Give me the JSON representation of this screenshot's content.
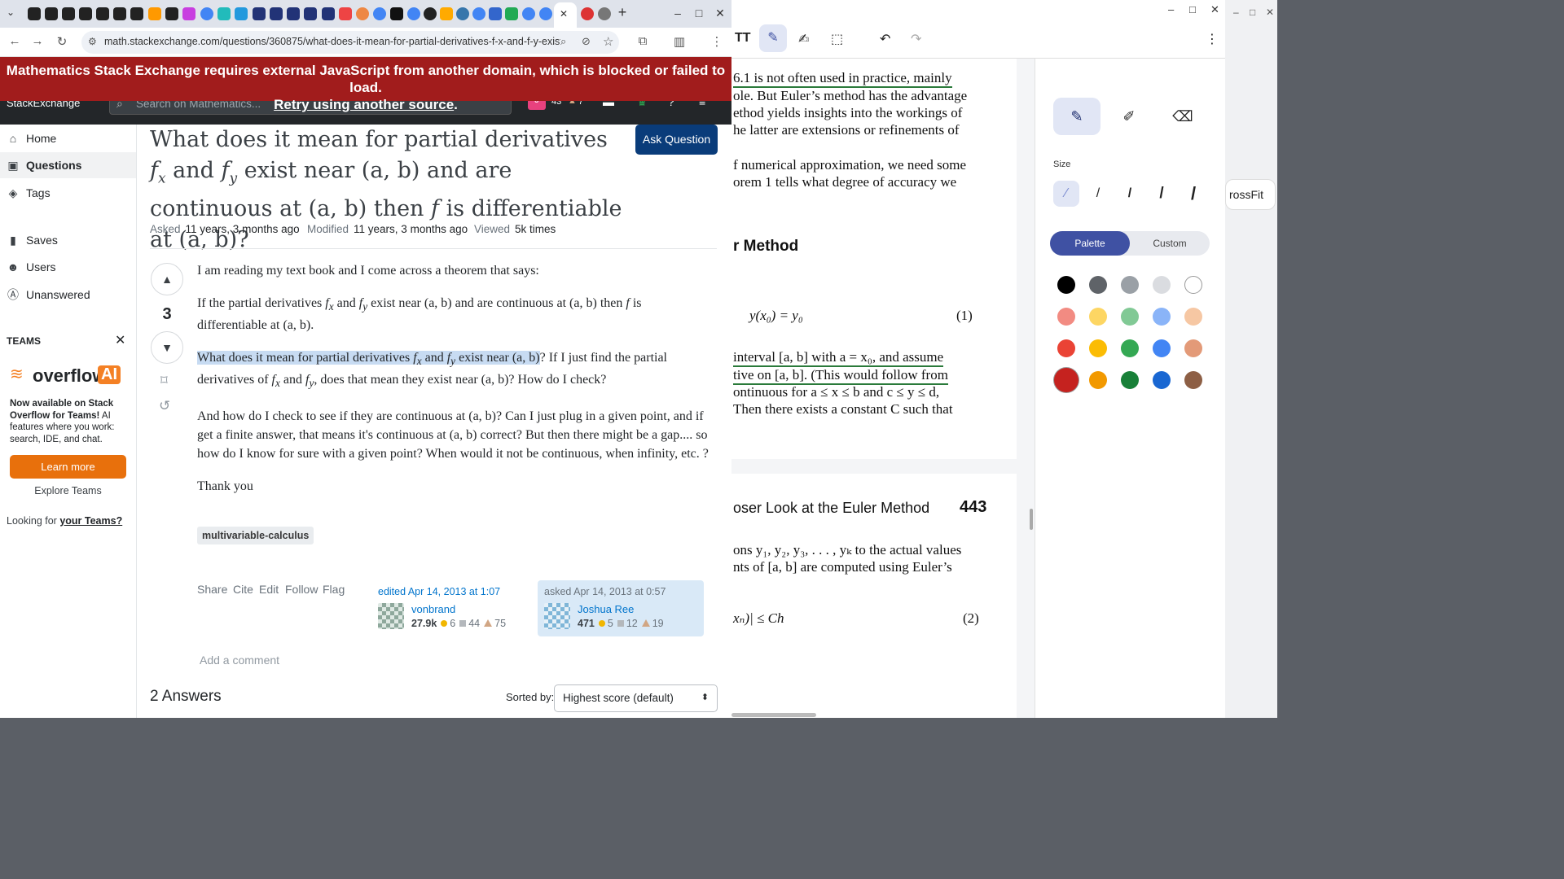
{
  "browser": {
    "url": "math.stackexchange.com/questions/360875/what-does-it-mean-for-partial-derivatives-f-x-and-f-y-exist-nea...",
    "new_tab": "+",
    "minimize": "–",
    "maximize": "□",
    "close": "✕",
    "tab_close": "✕"
  },
  "banner": {
    "line1": "Mathematics Stack Exchange requires external JavaScript from another domain, which is blocked or failed to load.",
    "retry_link": "Retry using another source",
    "period": "."
  },
  "sitebar": {
    "logo": "StackExchange",
    "search_placeholder": "Search on Mathematics...",
    "rep": "43",
    "badge_count": "7",
    "avatar_letter": "J"
  },
  "nav": {
    "home": "Home",
    "questions": "Questions",
    "tags": "Tags",
    "saves": "Saves",
    "users": "Users",
    "unanswered": "Unanswered",
    "teams_heading": "TEAMS",
    "teams_logo_a": "overflow",
    "teams_logo_b": "AI",
    "teams_text_bold": "Now available on Stack Overflow for Teams!",
    "teams_text": " AI features where you work: search, IDE, and chat.",
    "learn_more": "Learn more",
    "explore": "Explore Teams",
    "looking": "Looking for ",
    "your_teams": "your Teams?"
  },
  "question": {
    "title_a": "What does it mean for partial derivatives ",
    "title_b": " and ",
    "title_c": " exist near (a, b) and are continuous at (a, b) then ",
    "title_d": " is differentiable at (a, b)?",
    "ask_button": "Ask Question",
    "asked_label": "Asked",
    "asked_value": "11 years, 3 months ago",
    "modified_label": "Modified",
    "modified_value": "11 years, 3 months ago",
    "viewed_label": "Viewed",
    "viewed_value": "5k times",
    "score": "3",
    "p1": "I am reading my text book and I come across a theorem that says:",
    "p2a": "If the partial derivatives ",
    "p2b": " and ",
    "p2c": " exist near ",
    "p2d": " and are continuous at ",
    "p2e": " then ",
    "p2f": " is differentiable at ",
    "p2g": ".",
    "p3_highlight_a": "What does it mean for partial derivatives ",
    "p3_highlight_b": " and ",
    "p3_highlight_c": " exist near ",
    "p3_rest_a": "? If I just find the partial derivatives of ",
    "p3_rest_b": " and ",
    "p3_rest_c": ", does that mean they exist near ",
    "p3_rest_d": "? How do I check?",
    "p4a": "And how do I check to see if they are continuous at ",
    "p4b": "? Can I just plug in a given point, and if get a finite answer, that means it's continuous at ",
    "p4c": " correct? But then there might be a gap.... so how do I know for sure with a given point? When would it not be continuous, when infinity, etc. ?",
    "p5": "Thank you",
    "m_fx": "fx",
    "m_fy": "fy",
    "m_f": "f",
    "m_ab": "(a, b)",
    "tag": "multivariable-calculus",
    "actions": {
      "share": "Share",
      "cite": "Cite",
      "edit": "Edit",
      "follow": "Follow",
      "flag": "Flag"
    },
    "edited": {
      "label": "edited Apr 14, 2013 at 1:07",
      "user": "vonbrand",
      "rep": "27.9k",
      "gold": "6",
      "silver": "44",
      "bronze": "75"
    },
    "asked": {
      "label": "asked Apr 14, 2013 at 0:57",
      "user": "Joshua Ree",
      "rep": "471",
      "gold": "5",
      "silver": "12",
      "bronze": "19"
    },
    "add_comment": "Add a comment",
    "answers_heading": "2 Answers",
    "sorted_by": "Sorted by:",
    "sort_value": "Highest score (default)"
  },
  "pdf": {
    "l1": "6.1 is not often used in practice, mainly",
    "l2": "ole. But Euler’s method has the advantage",
    "l3": "ethod yields insights into the workings of",
    "l4": "he latter are extensions or refinements of",
    "l5": "f numerical approximation, we need some",
    "l6": "orem 1 tells what degree of accuracy we",
    "heading": "r Method",
    "eq1": "y(x₀) = y₀",
    "eq1_num": "(1)",
    "l7": "interval [a, b] with a = x₀, and assume",
    "l8": "tive on [a, b]. (This would follow from",
    "l9": "ontinuous for a ≤ x ≤ b and c ≤ y ≤ d,",
    "l10": "Then there exists a constant C such that",
    "page2_head": "oser Look at the Euler Method",
    "page2_num": "443",
    "l11": "ons y₁, y₂, y₃, . . . , yₖ to the actual values",
    "l12": "nts of [a, b] are computed using Euler’s",
    "eq2": "xₙ)| ≤ Ch",
    "eq2_num": "(2)"
  },
  "annot": {
    "size_label": "Size",
    "palette": "Palette",
    "custom": "Custom",
    "side_tab": "rossFit",
    "colors": [
      "#000000",
      "#5f6368",
      "#9aa0a6",
      "#dadce0",
      "#ffffff",
      "#f28b82",
      "#fdd663",
      "#81c995",
      "#8ab4f8",
      "#f6c7a3",
      "#ea4335",
      "#fbbc04",
      "#34a853",
      "#4285f4",
      "#e39a78",
      "#c5221f",
      "#f29900",
      "#188038",
      "#1967d2",
      "#8d5f45"
    ]
  }
}
